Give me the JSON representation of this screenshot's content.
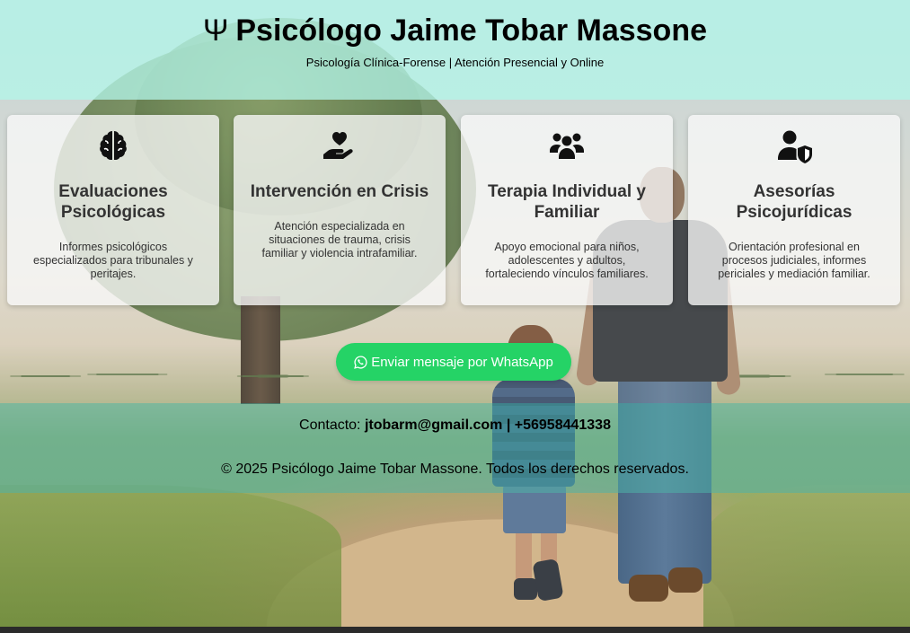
{
  "header": {
    "psi_symbol": "Ψ",
    "title": "Psicólogo Jaime Tobar Massone",
    "subtitle": "Psicología Clínica-Forense | Atención Presencial y Online"
  },
  "services": [
    {
      "icon": "brain-icon",
      "title": "Evaluaciones Psicológicas",
      "description": "Informes psicológicos especializados para tribunales y peritajes."
    },
    {
      "icon": "hand-holding-heart-icon",
      "title": "Intervención en Crisis",
      "description": "Atención especializada en situaciones de trauma, crisis familiar y violencia intrafamiliar."
    },
    {
      "icon": "users-group-icon",
      "title": "Terapia Individual y Familiar",
      "description": "Apoyo emocional para niños, adolescentes y adultos, fortaleciendo vínculos familiares."
    },
    {
      "icon": "user-shield-icon",
      "title": "Asesorías Psicojurídicas",
      "description": "Orientación profesional en procesos judiciales, informes periciales y mediación familiar."
    }
  ],
  "whatsapp": {
    "label": "Enviar mensaje por WhatsApp",
    "icon": "whatsapp-icon",
    "color": "#25d366"
  },
  "footer": {
    "contact_label": "Contacto:",
    "email": "jtobarm@gmail.com",
    "separator": "|",
    "phone": "+56958441338",
    "copyright": "© 2025 Psicólogo Jaime Tobar Massone. Todos los derechos reservados."
  },
  "colors": {
    "header_bg": "#b2f0e4",
    "footer_bg": "#4eb2a8",
    "card_bg": "#f8f8f8",
    "text": "#333333"
  }
}
